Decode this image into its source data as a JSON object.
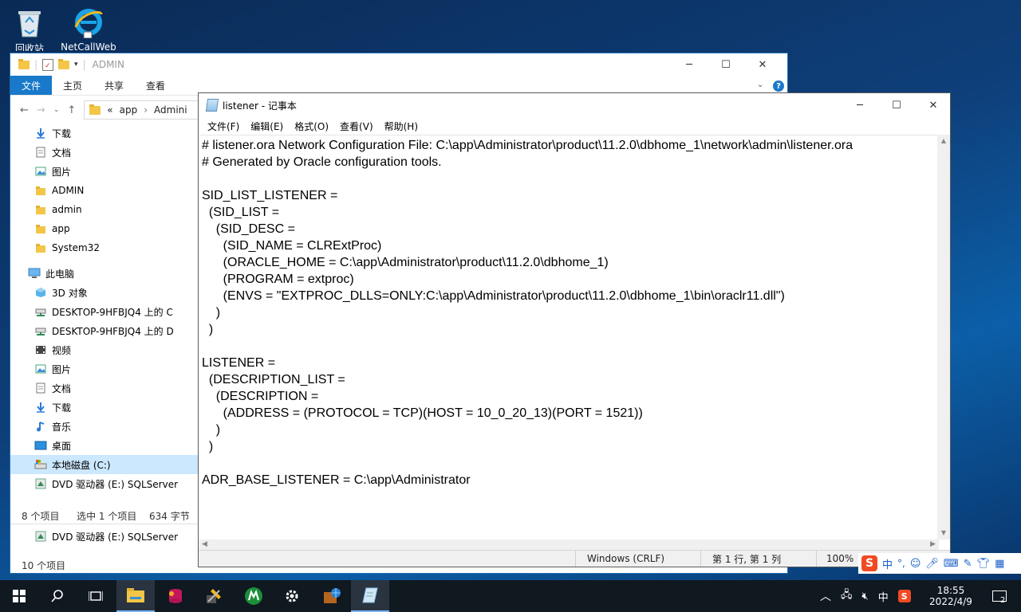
{
  "desktop": {
    "icons": [
      {
        "label": "回收站",
        "icon": "recycle-bin-icon"
      },
      {
        "label": "NetCallWeb",
        "icon": "ie-icon"
      }
    ]
  },
  "explorer": {
    "title": "ADMIN",
    "ribbon_tabs": [
      "文件",
      "主页",
      "共享",
      "查看"
    ],
    "address": {
      "prefix": "«",
      "parts": [
        "app",
        "Admini"
      ]
    },
    "nav": [
      {
        "label": "下载",
        "icon": "download-arrow-icon"
      },
      {
        "label": "文档",
        "icon": "document-icon"
      },
      {
        "label": "图片",
        "icon": "picture-icon"
      },
      {
        "label": "ADMIN",
        "icon": "folder-icon"
      },
      {
        "label": "admin",
        "icon": "folder-icon"
      },
      {
        "label": "app",
        "icon": "folder-icon"
      },
      {
        "label": "System32",
        "icon": "folder-icon"
      },
      {
        "label": "此电脑",
        "icon": "computer-icon"
      },
      {
        "label": "3D 对象",
        "icon": "cube-3d-icon"
      },
      {
        "label": "DESKTOP-9HFBJQ4 上的 C",
        "icon": "network-drive-icon"
      },
      {
        "label": "DESKTOP-9HFBJQ4 上的 D",
        "icon": "network-drive-icon"
      },
      {
        "label": "视频",
        "icon": "video-icon"
      },
      {
        "label": "图片",
        "icon": "picture-icon"
      },
      {
        "label": "文档",
        "icon": "document-icon"
      },
      {
        "label": "下载",
        "icon": "download-arrow-icon"
      },
      {
        "label": "音乐",
        "icon": "music-note-icon"
      },
      {
        "label": "桌面",
        "icon": "desktop-icon"
      },
      {
        "label": "本地磁盘 (C:)",
        "icon": "drive-icon"
      },
      {
        "label": "DVD 驱动器 (E:) SQLServer",
        "icon": "dvd-icon"
      }
    ],
    "status1": {
      "items": "8 个项目",
      "selected": "选中 1 个项目",
      "size": "634 字节"
    },
    "behind_nav": {
      "label": "DVD 驱动器 (E:) SQLServer"
    },
    "status2": "10 个项目"
  },
  "notepad": {
    "title": "listener - 记事本",
    "menu": [
      "文件(F)",
      "编辑(E)",
      "格式(O)",
      "查看(V)",
      "帮助(H)"
    ],
    "content": "# listener.ora Network Configuration File: C:\\app\\Administrator\\product\\11.2.0\\dbhome_1\\network\\admin\\listener.ora\n# Generated by Oracle configuration tools.\n\nSID_LIST_LISTENER =\n  (SID_LIST =\n    (SID_DESC =\n      (SID_NAME = CLRExtProc)\n      (ORACLE_HOME = C:\\app\\Administrator\\product\\11.2.0\\dbhome_1)\n      (PROGRAM = extproc)\n      (ENVS = \"EXTPROC_DLLS=ONLY:C:\\app\\Administrator\\product\\11.2.0\\dbhome_1\\bin\\oraclr11.dll\")\n    )\n  )\n\nLISTENER =\n  (DESCRIPTION_LIST =\n    (DESCRIPTION =\n      (ADDRESS = (PROTOCOL = TCP)(HOST = 10_0_20_13)(PORT = 1521))\n    )\n  )\n\nADR_BASE_LISTENER = C:\\app\\Administrator",
    "status": {
      "encoding": "Windows (CRLF)",
      "position": "第 1 行, 第 1 列",
      "zoom": "100%"
    }
  },
  "ime": {
    "mode": "中",
    "punct": "°,"
  },
  "taskbar": {
    "tray_lang": "中",
    "time": "18:55",
    "date": "2022/4/9",
    "notifications": "2"
  },
  "colors": {
    "accent": "#1979ca",
    "selection": "#cce8ff",
    "taskbar": "#101820"
  }
}
